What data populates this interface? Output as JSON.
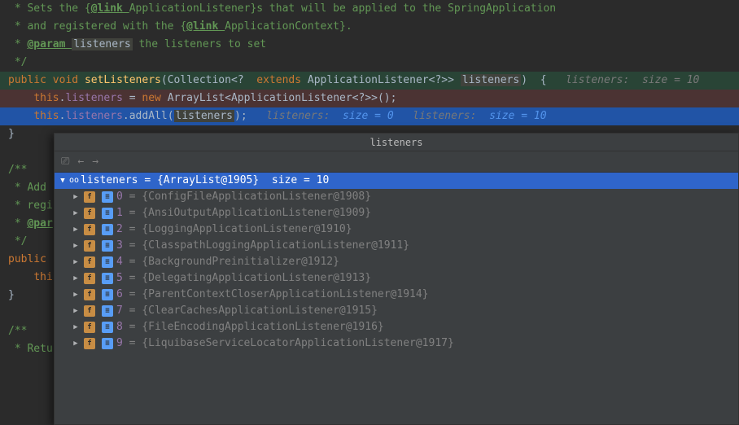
{
  "code": {
    "c1": " * Sets the {",
    "c1b": "ApplicationListener",
    "c1c": "}s that will be applied to the SpringApplication",
    "c2": " * and registered with the {",
    "c2b": "ApplicationContext",
    "c2c": "}.",
    "c3a": " * ",
    "c3b": "listeners",
    "c3c": " the listeners to set",
    "c4": " */",
    "pub": "public ",
    "voi": "void ",
    "mset": "setListeners",
    "pColl": "Collection",
    "pExt": " extends ",
    "pAL": "ApplicationListener",
    "pParam": "listeners",
    "brace": " {",
    "inlay1a": "listeners:  ",
    "inlay1b": "size = 10",
    "tthis": "this",
    "tlist": "listeners",
    "eqnew": " = ",
    "new": "new ",
    "newT": "ArrayList<ApplicationListener<?>>",
    "newE": "();",
    "addAll": "addAll",
    "argl": "listeners",
    "end": ";",
    "inlay2a": "listeners:  ",
    "inlay2b": "size = 0",
    "inlay3a": "listeners:  ",
    "inlay3b": "size = 10",
    "brC": "}",
    "doc2": "/**",
    "doc3": " * Add ",
    "doc4": " * regi",
    "doc5": " * ",
    "doc6": " */",
    "pub2": "public",
    "thi2": "thi",
    "brC2": "}",
    "doc7": "/**",
    "doc8": " * Retu",
    "link": "@link ",
    "param": "@param ",
    "parTag": "@par",
    "q": "<? ",
    "qend": "<?>> ",
    "open": "(",
    "close": ") ",
    "dot": ".",
    "openp": "(",
    "closep": ")"
  },
  "popup": {
    "title": "listeners",
    "root": {
      "name": "listeners",
      "val": "{ArrayList@1905}  size = 10"
    },
    "items": [
      {
        "i": "0",
        "v": "{ConfigFileApplicationListener@1908}"
      },
      {
        "i": "1",
        "v": "{AnsiOutputApplicationListener@1909}"
      },
      {
        "i": "2",
        "v": "{LoggingApplicationListener@1910}"
      },
      {
        "i": "3",
        "v": "{ClasspathLoggingApplicationListener@1911}"
      },
      {
        "i": "4",
        "v": "{BackgroundPreinitializer@1912}"
      },
      {
        "i": "5",
        "v": "{DelegatingApplicationListener@1913}"
      },
      {
        "i": "6",
        "v": "{ParentContextCloserApplicationListener@1914}"
      },
      {
        "i": "7",
        "v": "{ClearCachesApplicationListener@1915}"
      },
      {
        "i": "8",
        "v": "{FileEncodingApplicationListener@1916}"
      },
      {
        "i": "9",
        "v": "{LiquibaseServiceLocatorApplicationListener@1917}"
      }
    ]
  }
}
